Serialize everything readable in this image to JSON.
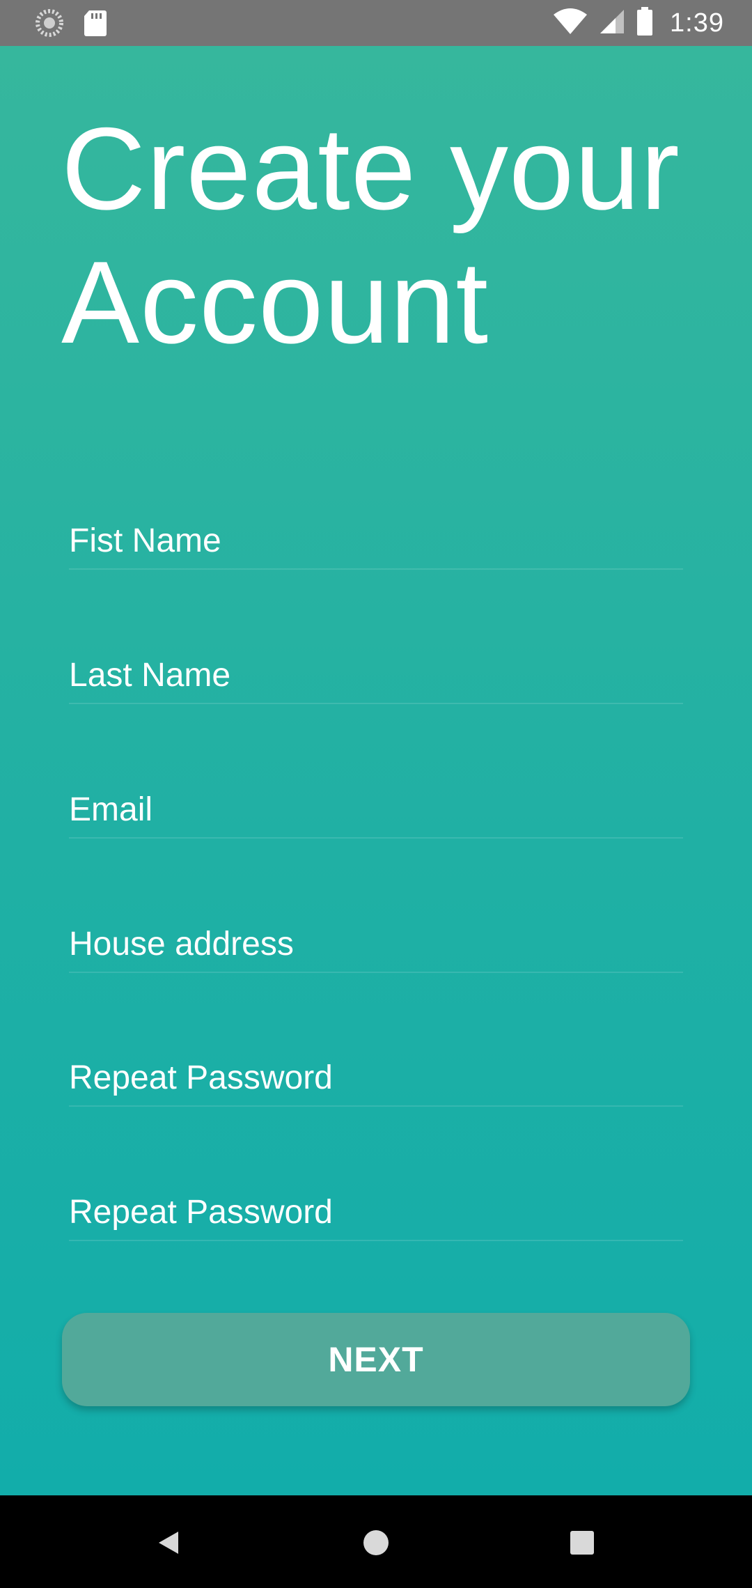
{
  "status_bar": {
    "time": "1:39",
    "icons": [
      "loading-circle-icon",
      "sd-card-icon",
      "wifi-icon",
      "cell-signal-icon",
      "battery-icon"
    ]
  },
  "page": {
    "title": "Create your Account",
    "background_colors": [
      "#36b79d",
      "#12adaa"
    ]
  },
  "form": {
    "fields": [
      {
        "label": "Fist Name"
      },
      {
        "label": "Last Name"
      },
      {
        "label": "Email"
      },
      {
        "label": "House address"
      },
      {
        "label": "Repeat Password"
      },
      {
        "label": "Repeat Password"
      }
    ],
    "next_label": "NEXT",
    "button_color": "#52a99a"
  },
  "nav_bar": {
    "icons": [
      "back-icon",
      "home-icon",
      "recents-icon"
    ]
  }
}
